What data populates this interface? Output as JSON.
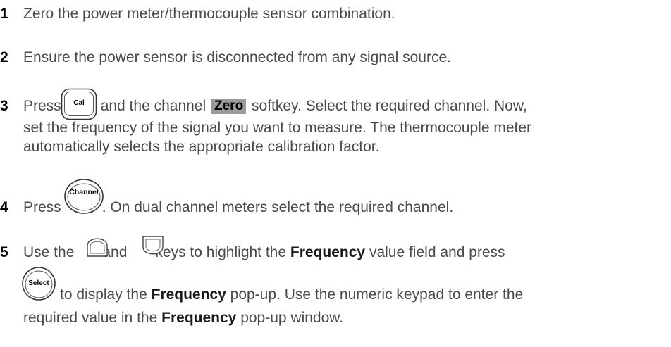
{
  "steps": [
    {
      "num": "1",
      "text": "Zero the power meter/thermocouple sensor combination."
    },
    {
      "num": "2",
      "text": "Ensure the power sensor is disconnected from any signal source."
    },
    {
      "num": "3",
      "press": "Press",
      "key_cal": "Cal",
      "after_cal": "and the channel",
      "softkey_zero": "Zero",
      "after_zero": "softkey. Select the required channel. Now,",
      "line2": "set the frequency of the signal you want to measure. The thermocouple meter",
      "line3": "automatically selects the appropriate calibration factor."
    },
    {
      "num": "4",
      "press": "Press",
      "key_channel": "Channel",
      "after": ". On dual channel meters select the required channel."
    },
    {
      "num": "5",
      "use_the": "Use the",
      "and": "and",
      "keys_to_highlight": "keys to highlight the",
      "frequency_bold": "Frequency",
      "value_field": "value field and press",
      "key_select": "Select",
      "to_display": "to display the",
      "popup_rest": "pop-up. Use the numeric keypad to enter the",
      "required_value": "required value in the",
      "popup_window": "pop-up window."
    }
  ]
}
